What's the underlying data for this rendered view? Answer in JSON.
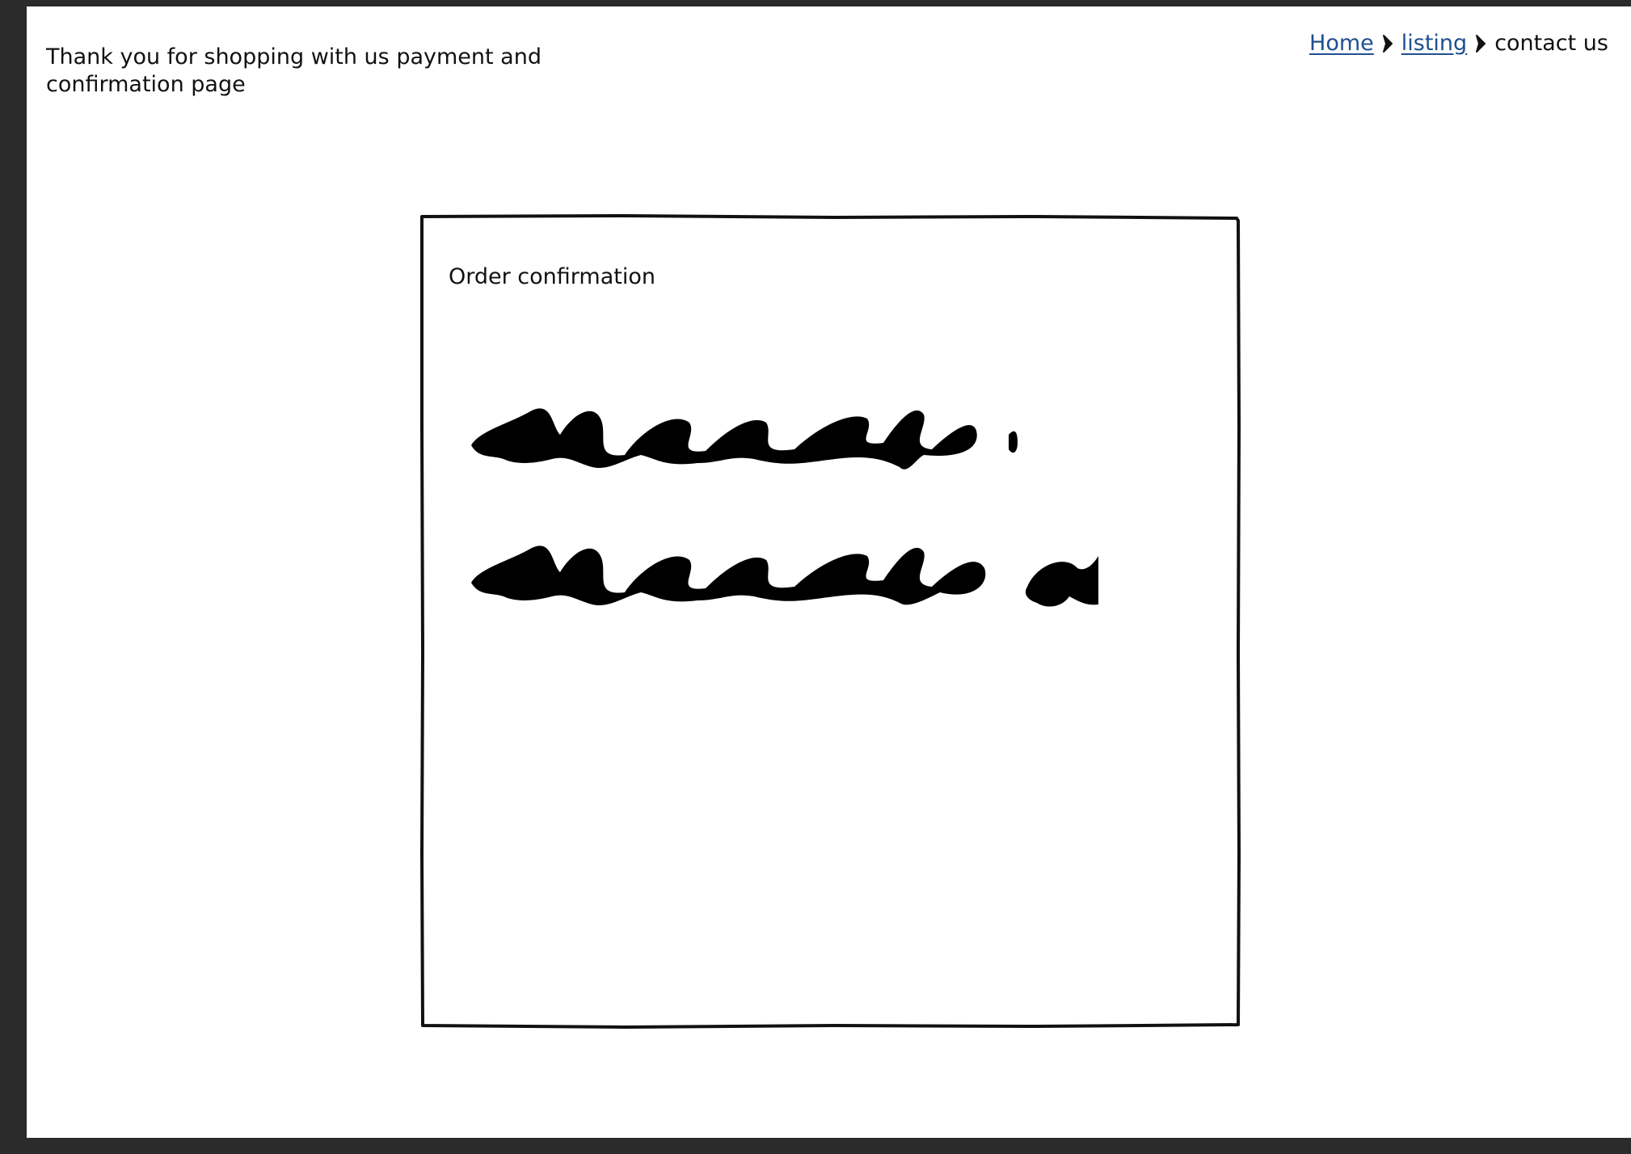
{
  "page": {
    "heading": "Thank you for shopping with us payment and confirmation page"
  },
  "breadcrumb": {
    "items": [
      {
        "label": "Home",
        "link": true
      },
      {
        "label": "listing",
        "link": true
      },
      {
        "label": "contact us",
        "link": false
      }
    ]
  },
  "confirmation": {
    "title": "Order confirmation",
    "lines": [
      "redacted-scribble-line-1",
      "redacted-scribble-line-2"
    ]
  },
  "colors": {
    "background": "#2b2b2b",
    "canvas": "#ffffff",
    "text": "#111111",
    "link": "#1f4f8f"
  }
}
